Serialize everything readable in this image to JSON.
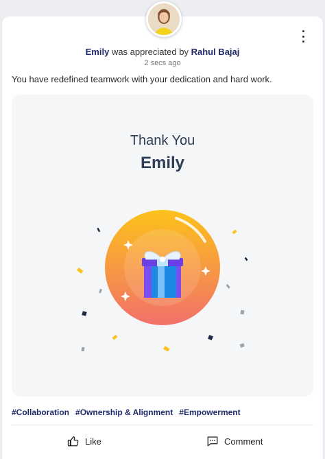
{
  "post": {
    "recipient": "Emily",
    "verb": "was appreciated by",
    "sender": "Rahul Bajaj",
    "timestamp": "2 secs ago",
    "message": "You have redefined teamwork with your dedication and hard work."
  },
  "banner": {
    "subtitle": "Thank You",
    "name": "Emily"
  },
  "tags": [
    "#Collaboration",
    "#Ownership & Alignment",
    "#Empowerment"
  ],
  "actions": {
    "like_label": "Like",
    "comment_label": "Comment"
  },
  "colors": {
    "accent_text": "#1f2a6b",
    "banner_bg": "#f5f6f8",
    "orb_top": "#fdc21a",
    "orb_bottom": "#f1706a",
    "gift_purple": "#7b4ef2",
    "gift_blue": "#1e88e5"
  },
  "icons": {
    "menu": "kebab-icon",
    "like": "thumbs-up-icon",
    "comment": "comment-icon",
    "gift": "gift-icon"
  }
}
